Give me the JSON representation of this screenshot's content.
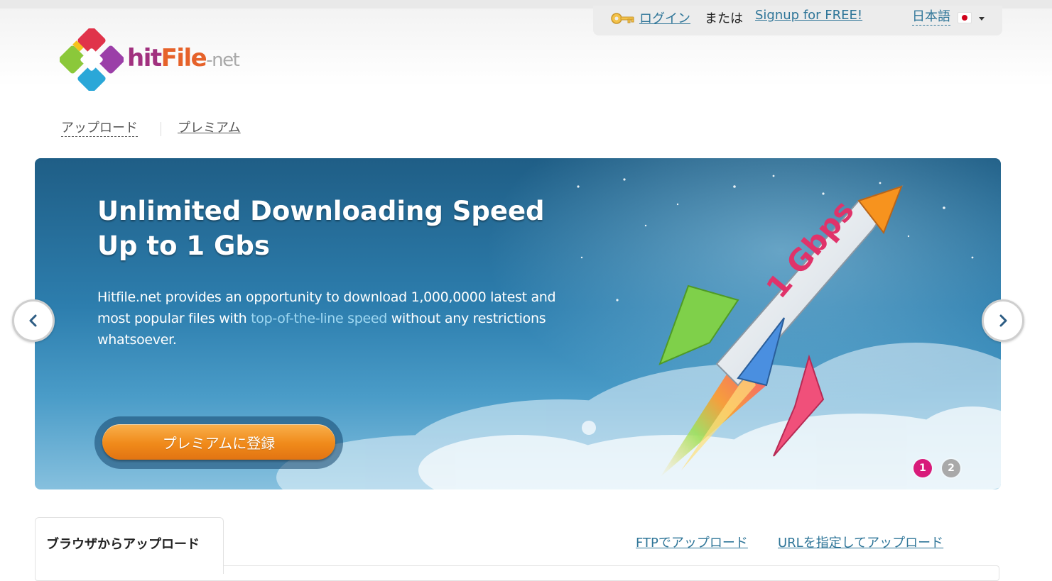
{
  "header": {
    "login_label": "ログイン",
    "or_text": "または",
    "signup_label": "Signup for FREE!",
    "language_label": "日本語",
    "icons": [
      "key-icon",
      "japan-flag-icon",
      "caret-down-icon"
    ]
  },
  "logo": {
    "part1": "hit",
    "part2": "File",
    "part3": "-net",
    "colors": {
      "hit": "#a1317f",
      "file": "#e6622a",
      "net": "#a9a9a9"
    }
  },
  "nav": {
    "upload_label": "アップロード",
    "premium_label": "プレミアム"
  },
  "banner": {
    "title_line1": "Unlimited Downloading Speed",
    "title_line2": "Up to 1 Gbs",
    "desc_before": "Hitfile.net provides an opportunity to download 1,000,0000 latest and most popular files with ",
    "desc_highlight": "top-of-the-line speed",
    "desc_after": " without any restrictions whatsoever.",
    "rocket_label": "1 Gbps",
    "cta_label": "プレミアムに登録",
    "pagination": [
      "1",
      "2"
    ],
    "active_page": "1",
    "colors": {
      "cta": "#f08a1a",
      "active_dot": "#d81b7a",
      "inactive_dot": "#a9a9a9",
      "highlight": "#9fd8f2"
    }
  },
  "carousel": {
    "icons": [
      "chevron-left-icon",
      "chevron-right-icon"
    ]
  },
  "upload_tabs": {
    "browser_label": "ブラウザからアップロード",
    "ftp_label": "FTPでアップロード",
    "url_label": "URLを指定してアップロード"
  },
  "theme": {
    "link_color": "#2e7598"
  }
}
